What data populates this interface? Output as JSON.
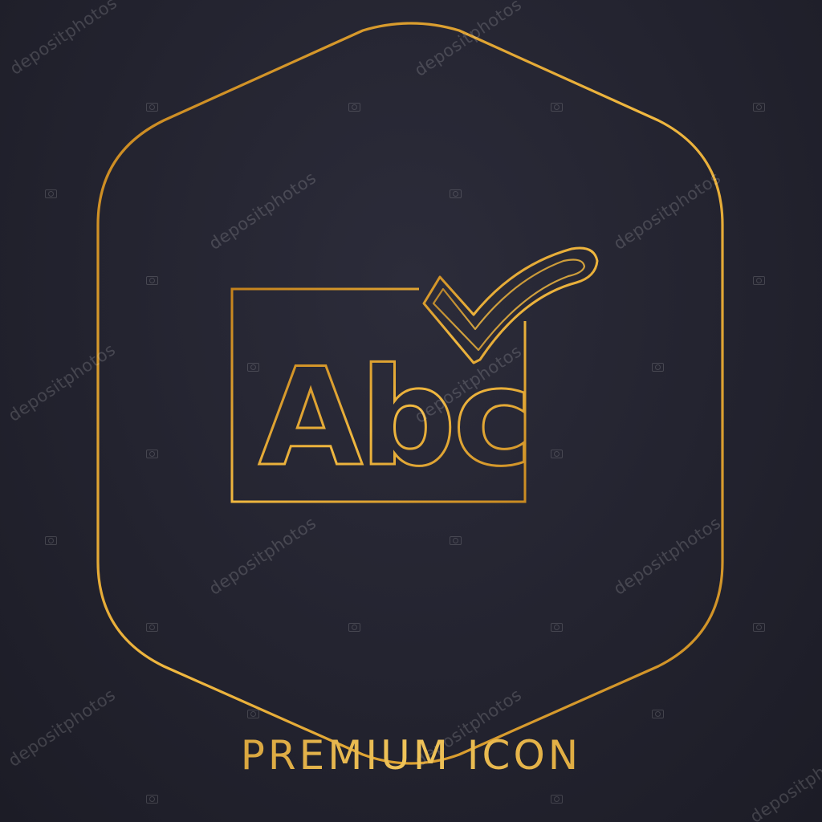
{
  "icon": {
    "name": "abc-check-icon",
    "letters": "Abc",
    "line_color": "#d69b2a",
    "background_color": "#23232f"
  },
  "caption": "PREMIUM ICON",
  "watermark": {
    "text": "depositphotos"
  }
}
